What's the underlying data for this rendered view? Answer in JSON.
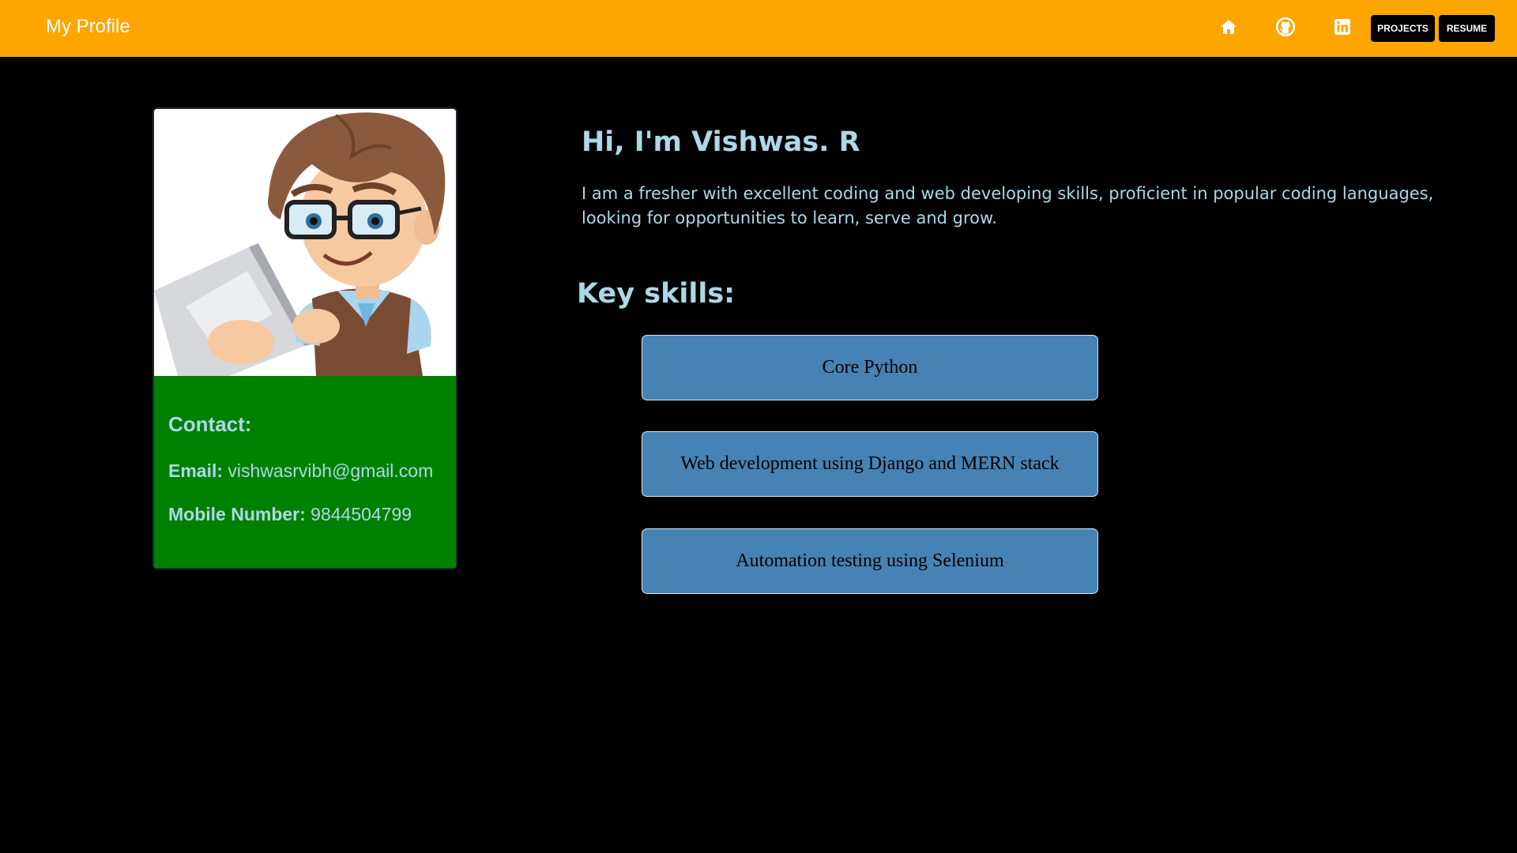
{
  "navbar": {
    "brand": "My Profile",
    "icons": [
      "home-icon",
      "github-icon",
      "linkedin-icon"
    ],
    "buttons": {
      "projects": "PROJECTS",
      "resume": "RESUME"
    },
    "colors": {
      "background": "#ffa500",
      "button_bg": "#000000",
      "button_text": "#ffffff"
    }
  },
  "profile_card": {
    "avatar": "cartoon-developer-with-laptop",
    "contact": {
      "heading": "Contact:",
      "email_label": "Email:",
      "email": "vishwasrvibh@gmail.com",
      "mobile_label": "Mobile Number:",
      "mobile": "9844504799"
    },
    "colors": {
      "contact_bg": "#008000",
      "contact_text": "#add8e6"
    }
  },
  "intro": {
    "title": "Hi, I'm Vishwas. R",
    "description": "I am a fresher with excellent coding and web developing skills, proficient in popular coding languages, looking for opportunities to learn, serve and grow."
  },
  "skills": {
    "heading": "Key skills:",
    "items": [
      {
        "label": "Core Python"
      },
      {
        "label": "Web development using Django and MERN stack"
      },
      {
        "label": "Automation testing using Selenium"
      }
    ],
    "colors": {
      "box_bg": "#4682b4",
      "box_text": "#000000"
    }
  },
  "page": {
    "background": "#000000",
    "accent_text": "#add8e6"
  }
}
